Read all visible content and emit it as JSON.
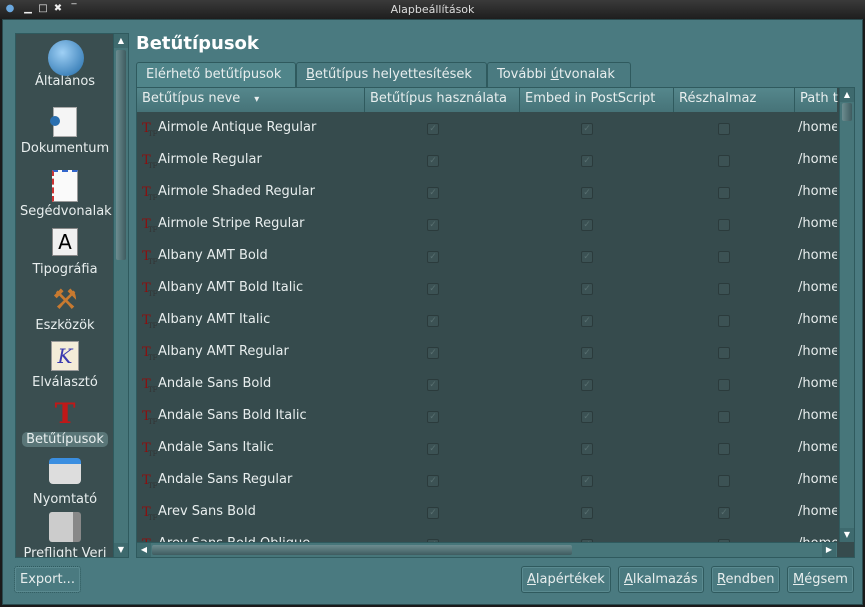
{
  "window": {
    "title": "Alapbeállítások"
  },
  "sidebar": {
    "items": [
      {
        "label": "Általános",
        "icon": "general-globe-icon"
      },
      {
        "label": "Dokumentum",
        "icon": "document-icon"
      },
      {
        "label": "Segédvonalak",
        "icon": "guides-icon"
      },
      {
        "label": "Tipográfia",
        "icon": "typography-icon"
      },
      {
        "label": "Eszközök",
        "icon": "hammer-icon"
      },
      {
        "label": "Elválasztó",
        "icon": "hyphenator-icon"
      },
      {
        "label": "Betűtípusok",
        "icon": "fonts-icon",
        "selected": true
      },
      {
        "label": "Nyomtató",
        "icon": "printer-icon"
      },
      {
        "label": "Preflight Veri",
        "icon": "preflight-icon"
      }
    ]
  },
  "page": {
    "title": "Betűtípusok"
  },
  "tabs": [
    {
      "label": "Elérhető betűtípusok",
      "active": true
    },
    {
      "pre": "",
      "ul": "B",
      "post": "etűtípus helyettesítések"
    },
    {
      "pre": "További ",
      "ul": "ú",
      "post": "tvonalak"
    }
  ],
  "table": {
    "columns": [
      "Betűtípus neve",
      "Betűtípus használata",
      "Embed in PostScript",
      "Részhalmaz",
      "Path t"
    ],
    "sort_indicator": "▾",
    "rows": [
      {
        "name": "Airmole Antique Regular",
        "use": true,
        "embed": true,
        "subset": false,
        "path": "/home"
      },
      {
        "name": "Airmole Regular",
        "use": true,
        "embed": true,
        "subset": false,
        "path": "/home"
      },
      {
        "name": "Airmole Shaded Regular",
        "use": true,
        "embed": true,
        "subset": false,
        "path": "/home"
      },
      {
        "name": "Airmole Stripe Regular",
        "use": true,
        "embed": true,
        "subset": false,
        "path": "/home"
      },
      {
        "name": "Albany AMT Bold",
        "use": true,
        "embed": true,
        "subset": false,
        "path": "/home"
      },
      {
        "name": "Albany AMT Bold Italic",
        "use": true,
        "embed": true,
        "subset": false,
        "path": "/home"
      },
      {
        "name": "Albany AMT Italic",
        "use": true,
        "embed": true,
        "subset": false,
        "path": "/home"
      },
      {
        "name": "Albany AMT Regular",
        "use": true,
        "embed": true,
        "subset": false,
        "path": "/home"
      },
      {
        "name": "Andale Sans Bold",
        "use": true,
        "embed": true,
        "subset": false,
        "path": "/home"
      },
      {
        "name": "Andale Sans Bold Italic",
        "use": true,
        "embed": true,
        "subset": false,
        "path": "/home"
      },
      {
        "name": "Andale Sans Italic",
        "use": true,
        "embed": true,
        "subset": false,
        "path": "/home"
      },
      {
        "name": "Andale Sans Regular",
        "use": true,
        "embed": true,
        "subset": false,
        "path": "/home"
      },
      {
        "name": "Arev Sans Bold",
        "use": true,
        "embed": true,
        "subset": true,
        "path": "/home"
      },
      {
        "name": "Arev Sans Bold Oblique",
        "use": true,
        "embed": true,
        "subset": false,
        "path": "/home"
      }
    ]
  },
  "buttons": {
    "export": "Export...",
    "defaults": {
      "ul": "A",
      "post": "lapértékek"
    },
    "apply": {
      "ul": "A",
      "post": "lkalmazás"
    },
    "ok": {
      "ul": "R",
      "post": "endben"
    },
    "cancel": {
      "ul": "M",
      "post": "égsem"
    }
  }
}
